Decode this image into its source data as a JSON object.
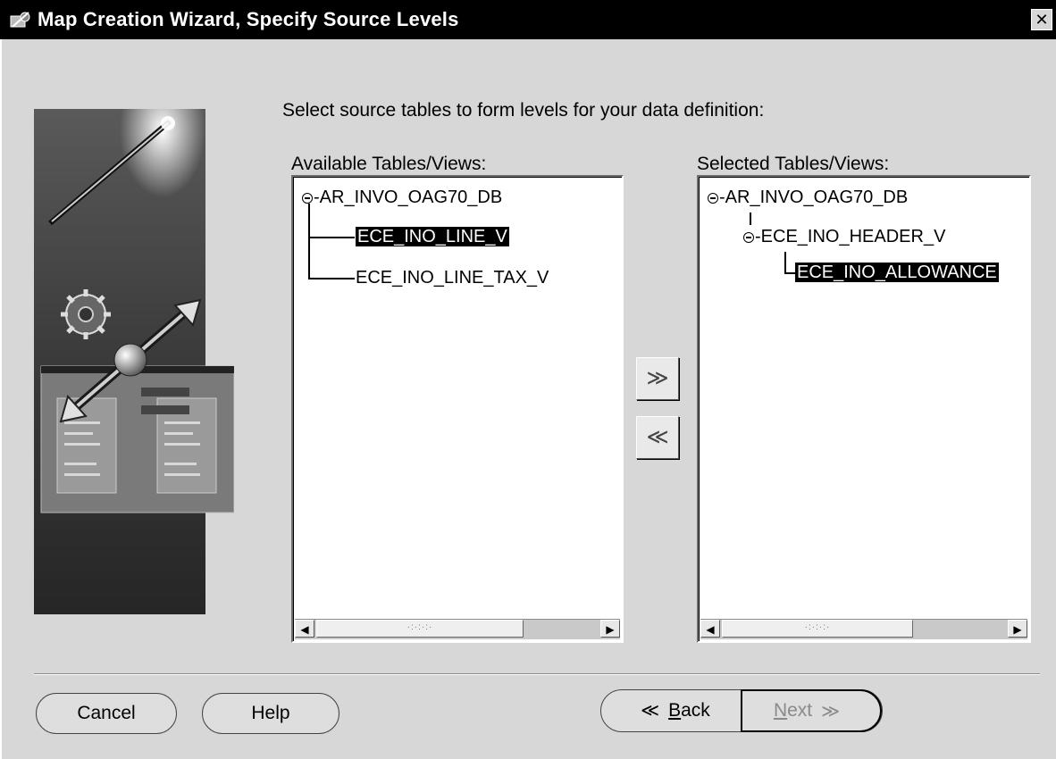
{
  "window": {
    "title": "Map Creation Wizard, Specify Source Levels",
    "title_icon": "wizard-app-icon",
    "close_glyph": "✕"
  },
  "instruction": "Select source tables to form levels for your data definition:",
  "available": {
    "label": "Available Tables/Views:",
    "root": "AR_INVO_OAG70_DB",
    "children": [
      {
        "label": "ECE_INO_LINE_V",
        "selected": true
      },
      {
        "label": "ECE_INO_LINE_TAX_V",
        "selected": false
      }
    ]
  },
  "selected": {
    "label": "Selected Tables/Views:",
    "root": "AR_INVO_OAG70_DB",
    "child": "ECE_INO_HEADER_V",
    "grandchild": "ECE_INO_ALLOWANCE",
    "grandchild_selected": true
  },
  "shuttle": {
    "add_glyph": "≫",
    "remove_glyph": "≪"
  },
  "scroll": {
    "left_glyph": "◀",
    "right_glyph": "▶",
    "grip": "·:·:·:·"
  },
  "buttons": {
    "cancel": "Cancel",
    "help": "Help",
    "back_glyph": "≪",
    "back_mnemonic": "B",
    "back_rest": "ack",
    "next_mnemonic": "N",
    "next_rest": "ext",
    "next_glyph": "≫",
    "next_enabled": false
  }
}
